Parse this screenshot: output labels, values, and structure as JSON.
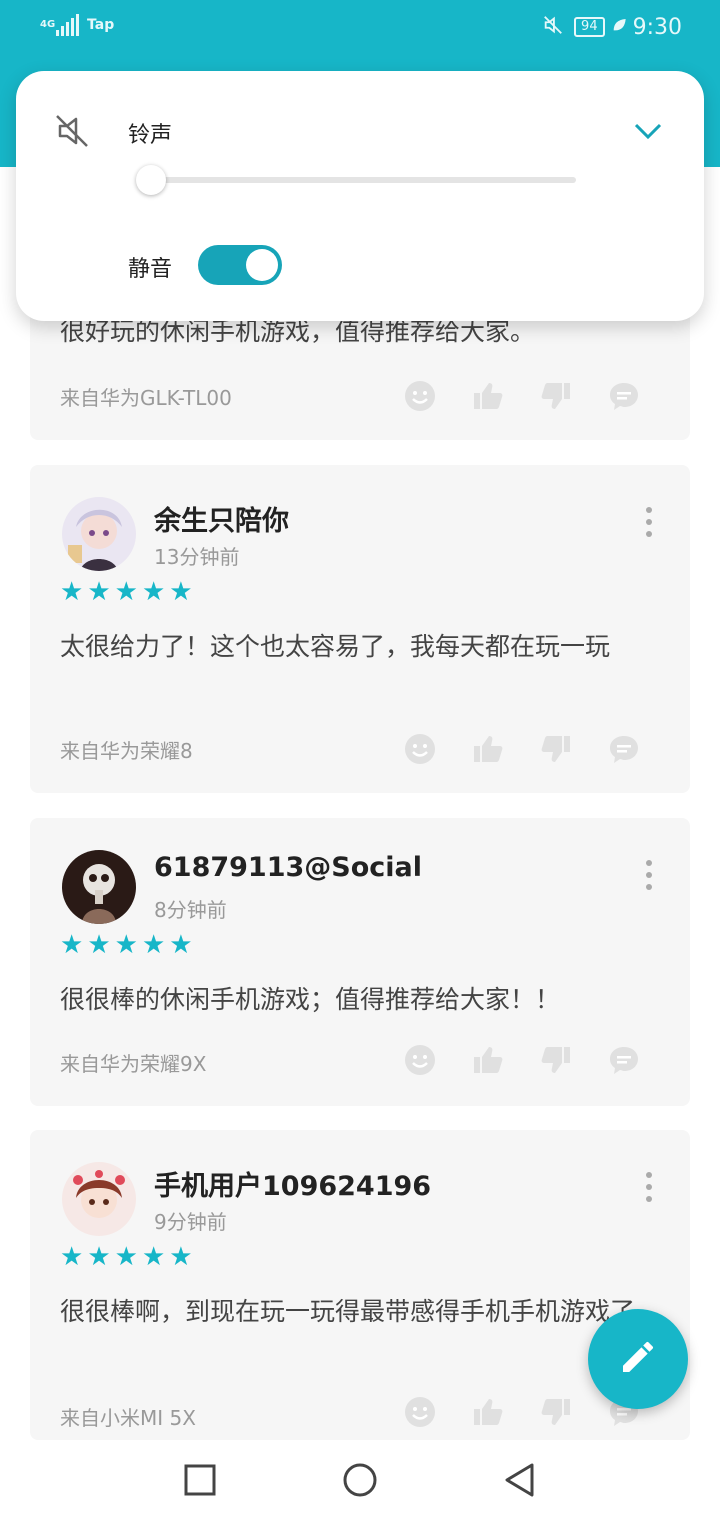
{
  "status_bar": {
    "network": "4G",
    "carrier": "Tap",
    "battery": "94",
    "time": "9:30"
  },
  "volume_panel": {
    "title": "铃声",
    "volume_level": 0,
    "silent_label": "静音",
    "silent_on": true
  },
  "reviews": [
    {
      "content": "很好玩的休闲手机游戏，值得推荐给大家。",
      "device": "来自华为GLK-TL00"
    },
    {
      "username": "余生只陪你",
      "time": "13分钟前",
      "rating": 5,
      "content": "太很给力了！这个也太容易了，我每天都在玩一玩",
      "device": "来自华为荣耀8"
    },
    {
      "username": "61879113@Social",
      "time": "8分钟前",
      "rating": 5,
      "content": "很很棒的休闲手机游戏；值得推荐给大家！！",
      "device": "来自华为荣耀9X"
    },
    {
      "username": "手机用户109624196",
      "time": "9分钟前",
      "rating": 5,
      "content": "很很棒啊，到现在玩一玩得最带感得手机手机游戏了",
      "device": "来自小米MI 5X"
    }
  ],
  "icons": {
    "emoji": "emoji-icon",
    "like": "thumb-up-icon",
    "dislike": "thumb-down-icon",
    "comment": "comment-icon",
    "fab": "edit-pencil-icon"
  },
  "colors": {
    "accent": "#17b6c8",
    "card_bg": "#f6f6f6",
    "toggle_on": "#17a4b8"
  }
}
